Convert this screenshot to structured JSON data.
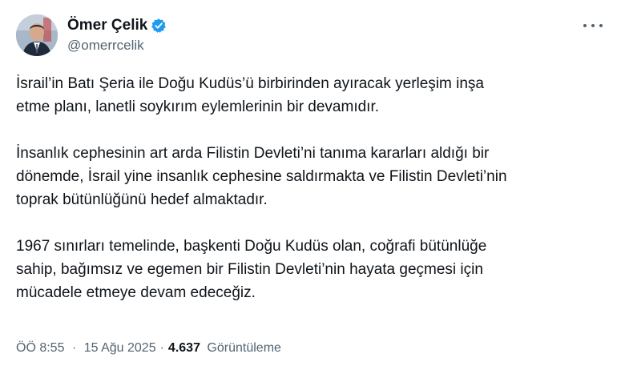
{
  "author": {
    "display_name": "Ömer Çelik",
    "handle": "@omerrcelik",
    "verified": true,
    "verified_color": "#1d9bf0"
  },
  "tweet": {
    "paragraphs": [
      "İsrail’in Batı Şeria ile Doğu Kudüs’ü birbirinden ayıracak yerleşim inşa\netme planı, lanetli soykırım eylemlerinin bir devamıdır.",
      "İnsanlık cephesinin art arda Filistin Devleti’ni tanıma kararları aldığı bir\ndönemde, İsrail yine insanlık cephesine saldırmakta ve Filistin Devleti’nin\ntoprak bütünlüğünü hedef almaktadır.",
      "1967 sınırları temelinde, başkenti Doğu Kudüs olan, coğrafi bütünlüğe\nsahip, bağımsız ve egemen bir Filistin Devleti’nin hayata geçmesi için\nmücadele etmeye devam edeceğiz."
    ]
  },
  "meta": {
    "time": "ÖÖ 8:55",
    "date": "15 Ağu 2025",
    "separator": "·",
    "views_count": "4.637",
    "views_label": "Görüntüleme"
  },
  "icons": {
    "more": "more-horizontal-icon",
    "verified": "verified-badge-icon"
  }
}
